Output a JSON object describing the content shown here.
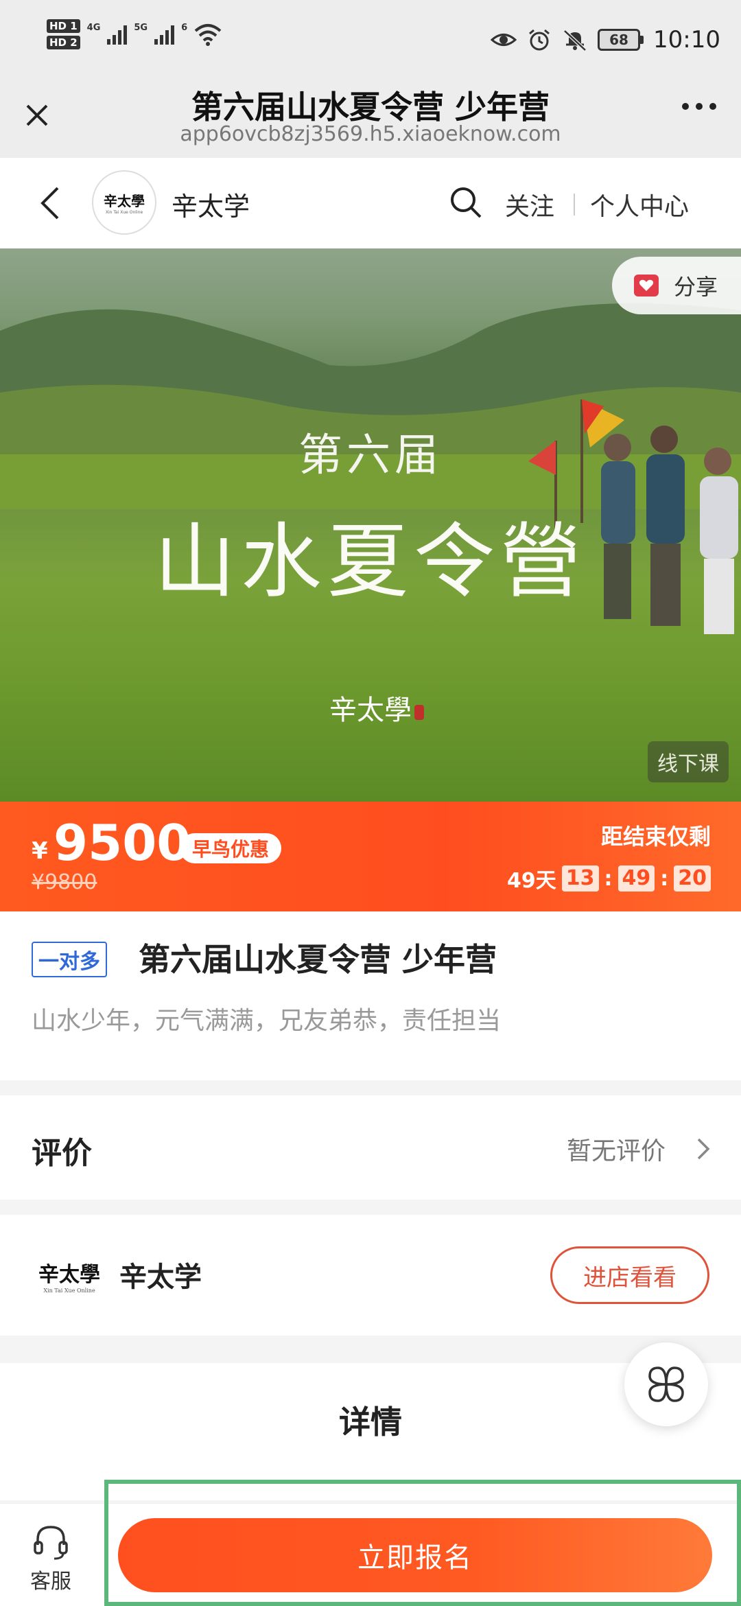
{
  "status_bar": {
    "hd1": "HD 1",
    "hd2": "HD 2",
    "net1": "4G",
    "net2": "5G",
    "wifi_num": "6",
    "battery": "68",
    "time": "10:10"
  },
  "title_bar": {
    "title": "第六届山水夏令营 少年营",
    "url": "app6ovcb8zj3569.h5.xiaoeknow.com"
  },
  "shop_header": {
    "logo_text": "辛太學",
    "logo_sub": "Xin Tai Xue Online",
    "shop_name": "辛太学",
    "follow": "关注",
    "personal_center": "个人中心"
  },
  "banner": {
    "line1": "第六届",
    "line2": "山水夏令營",
    "logo": "辛太學",
    "share": "分享",
    "offline_tag": "线下课"
  },
  "price": {
    "currency": "¥",
    "current": "9500",
    "badge": "早鸟优惠",
    "original": "¥9800",
    "countdown_label": "距结束仅剩",
    "days": "49天",
    "hours": "13",
    "minutes": "49",
    "seconds": "20"
  },
  "product": {
    "tag": "一对多",
    "title": "第六届山水夏令营 少年营",
    "subtitle": "山水少年，元气满满，兄友弟恭，责任担当"
  },
  "review": {
    "title": "评价",
    "status": "暂无评价"
  },
  "shop_row": {
    "logo": "辛太學",
    "logo_sub": "Xin Tai Xue Online",
    "name": "辛太学",
    "visit": "进店看看"
  },
  "details": {
    "title": "详情"
  },
  "bottom_bar": {
    "service": "客服",
    "enroll": "立即报名"
  },
  "colors": {
    "accent": "#ff4f1f",
    "tag_blue": "#2f68d8",
    "frame_green": "#5cb87a"
  }
}
